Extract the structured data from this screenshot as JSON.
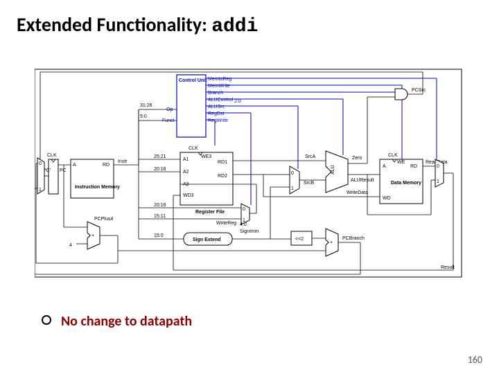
{
  "title_prefix": "Extended Functionality: ",
  "title_mono": "addi",
  "bullet_text": "No change to datapath",
  "page_number": "160",
  "diagram": {
    "control_unit": "Control Unit",
    "control_signals": [
      "MemtoReg",
      "MemWrite",
      "Branch",
      "ALUControl",
      "ALUSrc",
      "RegDst",
      "RegWrite"
    ],
    "control_sub": "2:0",
    "op": "Op",
    "funct": "Funct",
    "pc_prime": "PC'",
    "pc": "PC",
    "clk": "CLK",
    "instr_mem_a": "A",
    "instr_mem_rd": "RD",
    "instr_mem": "Instruction Memory",
    "instr": "Instr",
    "bits_3126": "31:26",
    "bits_50": "5:0",
    "bits_2521": "25:21",
    "bits_2016": "20:16",
    "bits_1511": "15:11",
    "bits_150": "15:0",
    "reg_a1": "A1",
    "reg_a2": "A2",
    "reg_a3": "A3",
    "reg_wd3": "WD3",
    "reg_we3": "WE3",
    "reg_rd1": "RD1",
    "reg_rd2": "RD2",
    "regfile": "Register File",
    "writereg": "WriteReg",
    "writereg_sub": "4:0",
    "signext": "Sign Extend",
    "signimm": "SignImm",
    "shift": "<<2",
    "pcplus4": "PCPlus4",
    "four": "4",
    "srcA": "SrcA",
    "srcB": "SrcB",
    "mux01_a": "0",
    "mux01_b": "1",
    "alu": "ALU",
    "zero": "Zero",
    "aluresult": "ALUResult",
    "writedata": "WriteData",
    "datamem_a": "A",
    "datamem_rd": "RD",
    "datamem_we": "WE",
    "datamem_wd": "WD",
    "datamem": "Data Memory",
    "readdata": "ReadData",
    "pcbranch": "PCBranch",
    "pcsrc": "PCSrc",
    "result": "Result"
  }
}
